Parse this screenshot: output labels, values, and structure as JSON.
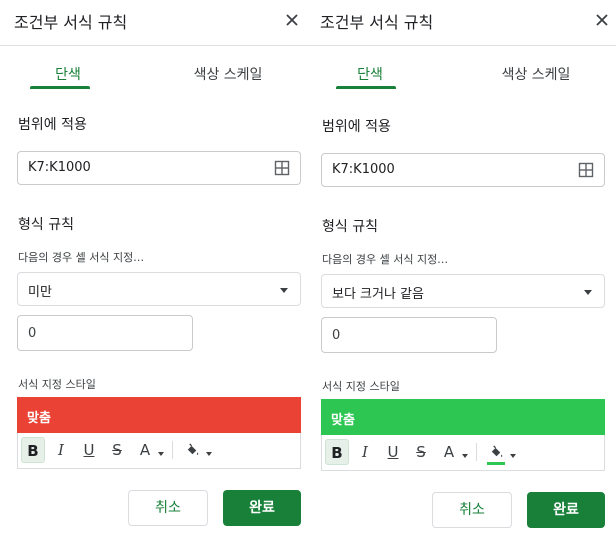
{
  "panels": [
    {
      "title": "조건부 서식 규칙",
      "tabs": {
        "single": "단색",
        "color_scale": "색상 스케일"
      },
      "apply_range_label": "범위에 적용",
      "range_value": "K7:K1000",
      "format_rules_label": "형식 규칙",
      "condition_label": "다음의 경우 셀 서식 지정…",
      "condition_value": "미만",
      "value_input": "0",
      "style_label": "서식 지정 스타일",
      "preview_text": "맞춤",
      "preview_color": "#ea4335",
      "fill_color": "",
      "toolbar": {
        "bold": "B",
        "italic": "I",
        "underline": "U",
        "strike": "S",
        "text_color": "A"
      },
      "cancel_label": "취소",
      "done_label": "완료"
    },
    {
      "title": "조건부 서식 규칙",
      "tabs": {
        "single": "단색",
        "color_scale": "색상 스케일"
      },
      "apply_range_label": "범위에 적용",
      "range_value": "K7:K1000",
      "format_rules_label": "형식 규칙",
      "condition_label": "다음의 경우 셀 서식 지정…",
      "condition_value": "보다 크거나 같음",
      "value_input": "0",
      "style_label": "서식 지정 스타일",
      "preview_text": "맞춤",
      "preview_color": "#2dc653",
      "fill_color": "#2dc653",
      "toolbar": {
        "bold": "B",
        "italic": "I",
        "underline": "U",
        "strike": "S",
        "text_color": "A"
      },
      "cancel_label": "취소",
      "done_label": "완료"
    }
  ],
  "colors": {
    "accent": "#188038",
    "border": "#dadce0"
  },
  "icons": {
    "close": "close-icon",
    "grid": "grid-select-icon",
    "fill": "paint-bucket-icon"
  }
}
